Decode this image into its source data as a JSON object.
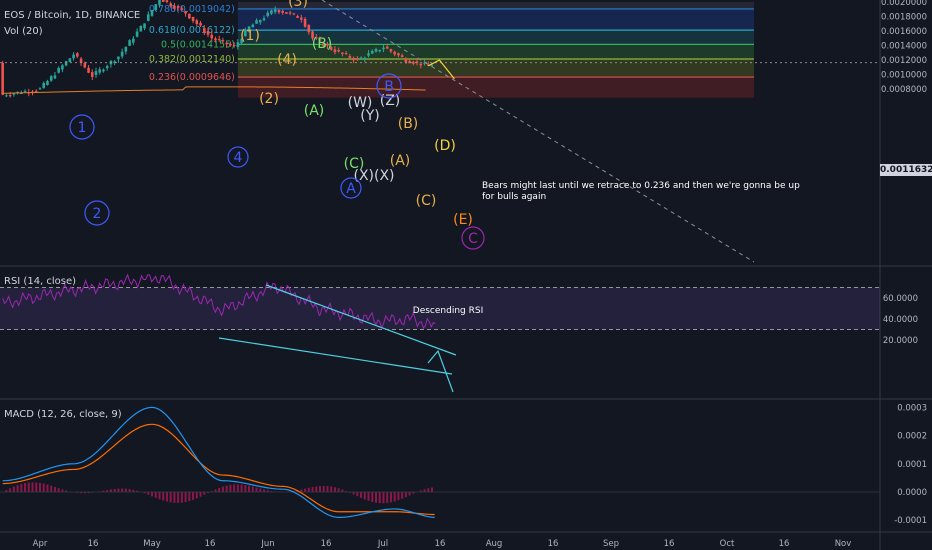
{
  "header": {
    "symbol": "EOS / Bitcoin, 1D, BINANCE",
    "volume_indicator": "Vol (20)",
    "rsi_indicator": "RSI (14, close)",
    "macd_indicator": "MACD (12, 26, close, 9)"
  },
  "price_axis": {
    "labels": [
      "0.0020000",
      "0.0018000",
      "0.0016000",
      "0.0014000",
      "0.0012000",
      "0.0010000",
      "0.0008000"
    ],
    "current_price": "0.0011632"
  },
  "rsi_axis": {
    "labels": [
      "60.0000",
      "40.0000",
      "20.0000"
    ]
  },
  "macd_axis": {
    "labels": [
      "0.0003",
      "0.0002",
      "0.0001",
      "0.0000",
      "-0.0001"
    ]
  },
  "time_axis": {
    "labels": [
      "Apr",
      "16",
      "May",
      "16",
      "Jun",
      "16",
      "Jul",
      "16",
      "Aug",
      "16",
      "Sep",
      "16",
      "Oct",
      "16",
      "Nov"
    ]
  },
  "fib_levels": [
    {
      "ratio": "0.786",
      "price": "0.0019042",
      "label": "0.786(0.0019042)",
      "color": "#2a7fd4"
    },
    {
      "ratio": "0.618",
      "price": "0.0016122",
      "label": "0.618(0.0016122)",
      "color": "#2aa5c9"
    },
    {
      "ratio": "0.5",
      "price": "0.0014155",
      "label": "0.5(0.0014155)",
      "color": "#35b35a"
    },
    {
      "ratio": "0.382",
      "price": "0.0012140",
      "label": "0.382(0.0012140)",
      "color": "#8fb83a"
    },
    {
      "ratio": "0.236",
      "price": "0.0009646",
      "label": "0.236(0.0009646)",
      "color": "#e0524d"
    }
  ],
  "wave_labels": [
    {
      "text": "(1)",
      "color": "#e8b04a"
    },
    {
      "text": "(2)",
      "color": "#e8b04a"
    },
    {
      "text": "(3)",
      "color": "#e8b04a"
    },
    {
      "text": "(4)",
      "color": "#e8b04a"
    },
    {
      "text": "(B)",
      "color": "#7ae06a"
    },
    {
      "text": "(A)",
      "color": "#7ae06a"
    },
    {
      "text": "(W)",
      "color": "#d1d4dc"
    },
    {
      "text": "(Y)",
      "color": "#d1d4dc"
    },
    {
      "text": "(Z)",
      "color": "#d1d4dc"
    },
    {
      "text": "(C)",
      "color": "#7ae06a"
    },
    {
      "text": "(X)(X)",
      "color": "#d1d4dc"
    },
    {
      "text": "(B)",
      "color": "#e8b04a"
    },
    {
      "text": "(A)",
      "color": "#e8b04a"
    },
    {
      "text": "(C)",
      "color": "#e8b04a"
    },
    {
      "text": "(D)",
      "color": "#f2d23c"
    },
    {
      "text": "(E)",
      "color": "#ff8a1a"
    }
  ],
  "circle_labels": [
    {
      "text": "1",
      "color": "#3d5afe"
    },
    {
      "text": "2",
      "color": "#3d5afe"
    },
    {
      "text": "4",
      "color": "#3d5afe"
    },
    {
      "text": "B",
      "color": "#3d5afe"
    },
    {
      "text": "A",
      "color": "#3d5afe"
    },
    {
      "text": "C",
      "color": "#9c27b0"
    }
  ],
  "annotations": {
    "bears_note": "Bears might last until we retrace to 0.236 and then we're gonna be up",
    "bears_note_line2": "for bulls again",
    "rsi_note": "Descending RSI"
  },
  "colors": {
    "up_candle": "#26a69a",
    "down_candle": "#ef5350",
    "background": "#131722",
    "rsi_line": "#9c27b0",
    "macd_line": "#2196f3",
    "signal_line": "#ff6d00",
    "trendline": "#4dd0e1"
  },
  "chart_data": [
    {
      "type": "candlestick",
      "title": "EOS / Bitcoin, 1D, BINANCE",
      "x_range": [
        "2018-03-20",
        "2018-11-10"
      ],
      "ylim": [
        0.00068,
        0.00205
      ],
      "series": [
        {
          "name": "price_path",
          "x": [
            "2018-03-22",
            "2018-04-01",
            "2018-04-10",
            "2018-04-15",
            "2018-04-22",
            "2018-04-28",
            "2018-05-03",
            "2018-05-10",
            "2018-05-17",
            "2018-05-23",
            "2018-05-27",
            "2018-06-03",
            "2018-06-10",
            "2018-06-13",
            "2018-06-20",
            "2018-06-25",
            "2018-07-02",
            "2018-07-08",
            "2018-07-14",
            "2018-07-16"
          ],
          "values": [
            0.00072,
            0.0008,
            0.00128,
            0.00098,
            0.00125,
            0.00165,
            0.00205,
            0.00185,
            0.0015,
            0.00138,
            0.00165,
            0.0019,
            0.00178,
            0.0015,
            0.0013,
            0.0012,
            0.00138,
            0.0012,
            0.00112,
            0.00116
          ]
        }
      ]
    },
    {
      "type": "line",
      "title": "RSI (14, close)",
      "ylim": [
        10,
        80
      ],
      "series": [
        {
          "name": "RSI",
          "x": [
            "2018-03-22",
            "2018-04-10",
            "2018-05-03",
            "2018-05-20",
            "2018-06-03",
            "2018-06-15",
            "2018-07-01",
            "2018-07-10",
            "2018-07-16"
          ],
          "values": [
            55,
            68,
            80,
            48,
            72,
            50,
            38,
            40,
            32
          ]
        }
      ]
    },
    {
      "type": "line",
      "title": "MACD (12, 26, close, 9)",
      "ylim": [
        -0.00015,
        0.00034
      ],
      "series": [
        {
          "name": "MACD",
          "x": [
            "2018-03-22",
            "2018-04-10",
            "2018-05-01",
            "2018-05-20",
            "2018-06-05",
            "2018-06-20",
            "2018-07-05",
            "2018-07-16"
          ],
          "values": [
            4e-05,
            0.0001,
            0.0003,
            4e-05,
            1e-05,
            -9e-05,
            -6e-05,
            -9e-05
          ]
        },
        {
          "name": "Signal",
          "x": [
            "2018-03-22",
            "2018-04-10",
            "2018-05-01",
            "2018-05-20",
            "2018-06-05",
            "2018-06-20",
            "2018-07-05",
            "2018-07-16"
          ],
          "values": [
            3e-05,
            8e-05,
            0.00024,
            6e-05,
            2e-05,
            -7e-05,
            -7e-05,
            -8e-05
          ]
        }
      ]
    }
  ]
}
